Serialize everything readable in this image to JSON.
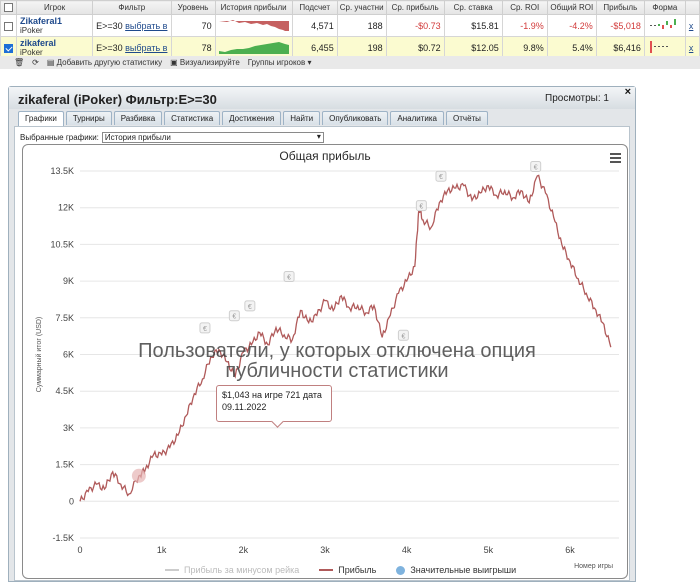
{
  "table": {
    "headers": [
      "",
      "Игрок",
      "Фильтр",
      "Уровень",
      "История прибыли",
      "Подсчет",
      "Ср. участни",
      "Ср. прибыль",
      "Ср. ставка",
      "Ср. ROI",
      "Общий ROI",
      "Прибыль",
      "Форма",
      ""
    ],
    "rows": [
      {
        "checked": false,
        "name": "Zikaferal1",
        "site": "iPoker",
        "filter": "E>=30",
        "filter_link": "выбрать в",
        "level": "70",
        "count": "4,571",
        "avg_field": "188",
        "avg_profit": "-$0.73",
        "avg_stake": "$15.81",
        "avg_roi": "-1.9%",
        "total_roi": "-4.2%",
        "profit": "-$5,018",
        "remove": "x"
      },
      {
        "checked": true,
        "name": "zikaferal",
        "site": "iPoker",
        "filter": "E>=30",
        "filter_link": "выбрать в",
        "level": "78",
        "count": "6,455",
        "avg_field": "198",
        "avg_profit": "$0.72",
        "avg_stake": "$12.05",
        "avg_roi": "9.8%",
        "total_roi": "5.4%",
        "profit": "$6,416",
        "remove": "x"
      }
    ]
  },
  "toolbar": {
    "add_label": "Добавить другую статистику",
    "visualize_label": "Визуализируйте",
    "groups_label": "Группы игроков"
  },
  "panel": {
    "title": "zikaferal (iPoker) Фильтр:E>=30",
    "views": "Просмотры: 1",
    "close": "×",
    "tabs": [
      "Графики",
      "Турниры",
      "Разбивка",
      "Статистика",
      "Достижения",
      "Найти",
      "Опубликовать",
      "Аналитика",
      "Отчёты"
    ],
    "active_tab": 0,
    "select_label": "Выбранные графики:",
    "select_value": "История прибыли"
  },
  "overlay": {
    "line1": "Пользователи, у которых отключена опция",
    "line2": "публичности статистики"
  },
  "tooltip": {
    "line1": "$1,043 на игре 721 дата",
    "line2": "09.11.2022"
  },
  "colors": {
    "profit_line": "#b05a5a",
    "big_win": "#7fb3de",
    "rake_line": "#cccccc"
  },
  "chart_data": {
    "type": "line",
    "title": "Общая прибыль",
    "ylabel": "Суммарный итог (USD)",
    "xlabel": "Номер игры",
    "xlim": [
      0,
      6600
    ],
    "ylim": [
      -1500,
      13500
    ],
    "x_ticks": [
      "0",
      "1k",
      "2k",
      "3k",
      "4k",
      "5k",
      "6k"
    ],
    "y_ticks": [
      "-1.5K",
      "0",
      "1.5K",
      "3K",
      "4.5K",
      "6K",
      "7.5K",
      "9K",
      "10.5K",
      "12K",
      "13.5K"
    ],
    "legend": [
      "Прибыль за минусом рейка",
      "Прибыль",
      "Значительные выигрыши"
    ],
    "legend_position": "bottom",
    "series": [
      {
        "name": "Прибыль",
        "x": [
          0,
          100,
          200,
          300,
          400,
          500,
          600,
          721,
          800,
          900,
          1000,
          1100,
          1200,
          1300,
          1400,
          1500,
          1600,
          1700,
          1800,
          1900,
          2000,
          2100,
          2200,
          2300,
          2400,
          2500,
          2600,
          2700,
          2800,
          2900,
          3000,
          3100,
          3200,
          3300,
          3400,
          3500,
          3600,
          3700,
          3800,
          3900,
          4000,
          4100,
          4150,
          4200,
          4300,
          4400,
          4500,
          4600,
          4700,
          4800,
          4900,
          5000,
          5100,
          5200,
          5300,
          5400,
          5500,
          5600,
          5700,
          5800,
          5900,
          6000,
          6100,
          6200,
          6300,
          6400,
          6500
        ],
        "y": [
          0,
          400,
          700,
          500,
          1200,
          700,
          300,
          1043,
          1300,
          1900,
          1900,
          2200,
          2700,
          3500,
          4400,
          5000,
          5900,
          6200,
          5700,
          5100,
          6100,
          6400,
          6900,
          6400,
          7100,
          6800,
          6600,
          7800,
          7300,
          7600,
          8200,
          7800,
          8400,
          7900,
          8000,
          7700,
          8000,
          6700,
          7600,
          8500,
          9000,
          9600,
          12000,
          11500,
          11200,
          12200,
          12700,
          12800,
          12900,
          12300,
          12600,
          12900,
          12500,
          12700,
          12400,
          12700,
          12200,
          13300,
          12600,
          11600,
          10500,
          9800,
          9100,
          8500,
          7900,
          7300,
          6300
        ]
      },
      {
        "name": "Значительные выигрыши",
        "x": [
          721,
          1530,
          1890,
          2080,
          2560,
          3960,
          4180,
          4420,
          5580
        ],
        "y": [
          1043,
          6800,
          7300,
          7700,
          8900,
          6500,
          11800,
          13000,
          13400
        ]
      }
    ]
  }
}
